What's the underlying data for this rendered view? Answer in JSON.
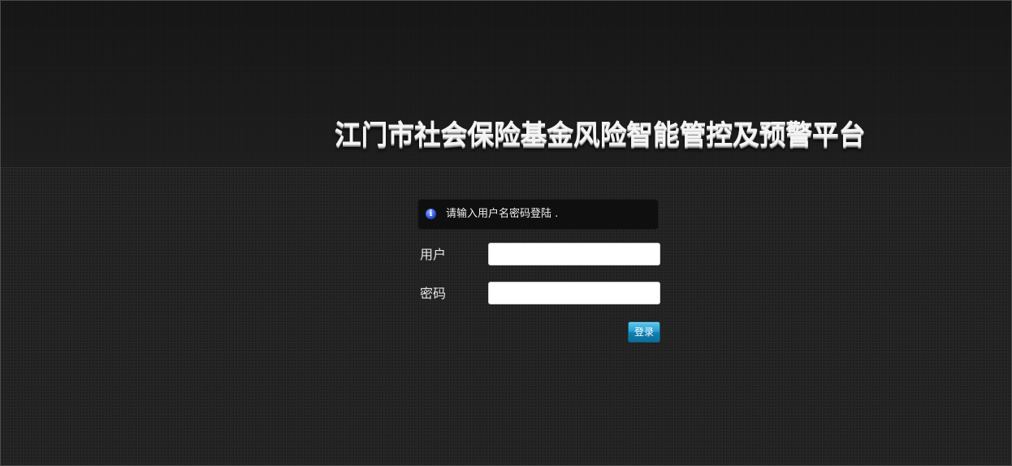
{
  "header": {
    "title": "江门市社会保险基金风险智能管控及预警平台"
  },
  "notice": {
    "icon": "info-icon",
    "icon_glyph": "i",
    "text": "请输入用户名密码登陆 ."
  },
  "form": {
    "username_label": "用户",
    "username_value": "",
    "password_label": "密码",
    "password_value": "",
    "login_label": "登录"
  },
  "colors": {
    "background": "#222222",
    "header_band": "#161616",
    "notice_box": "#0f0f0f",
    "button_blue": "#2a9fcf",
    "info_icon_blue": "#2a4fd6"
  }
}
